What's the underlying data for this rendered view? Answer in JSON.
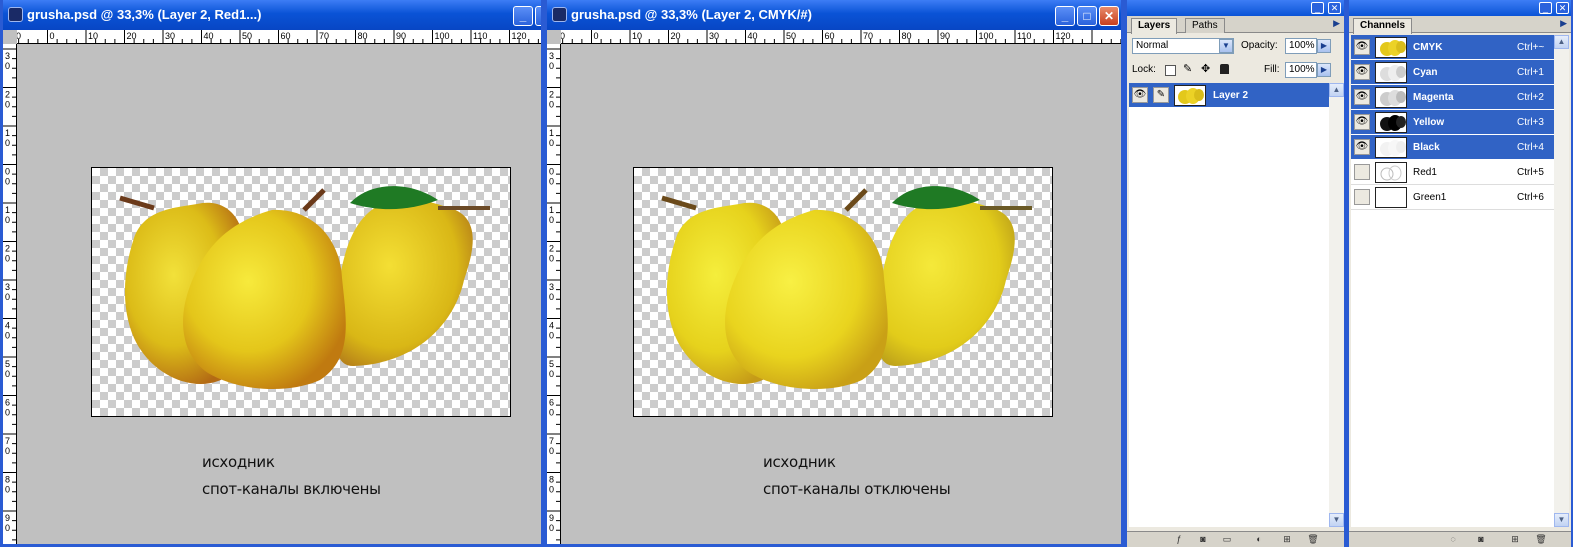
{
  "windows": [
    {
      "title": "grusha.psd @ 33,3% (Layer 2, Red1...)",
      "caption_line1": "исходник",
      "caption_line2": "спот-каналы включены"
    },
    {
      "title": "grusha.psd @ 33,3% (Layer 2, CMYK/#)",
      "caption_line1": "исходник",
      "caption_line2": "спот-каналы отключены"
    }
  ],
  "ruler": {
    "h_labels": [
      "10",
      "0",
      "10",
      "20",
      "30",
      "40",
      "50",
      "60",
      "70",
      "80",
      "90",
      "100",
      "110",
      "120"
    ],
    "v_labels": [
      "3",
      "2",
      "1",
      "0",
      "1",
      "2",
      "3",
      "4",
      "5",
      "6",
      "7",
      "8",
      "9"
    ]
  },
  "layers_panel": {
    "tabs": [
      "Layers",
      "Paths"
    ],
    "blend_mode": "Normal",
    "opacity_label": "Opacity:",
    "opacity_value": "100%",
    "lock_label": "Lock:",
    "fill_label": "Fill:",
    "fill_value": "100%",
    "layers": [
      {
        "name": "Layer 2"
      }
    ]
  },
  "channels_panel": {
    "tabs": [
      "Channels"
    ],
    "channels": [
      {
        "name": "CMYK",
        "shortcut": "Ctrl+~",
        "visible": true,
        "selected": true
      },
      {
        "name": "Cyan",
        "shortcut": "Ctrl+1",
        "visible": true,
        "selected": true
      },
      {
        "name": "Magenta",
        "shortcut": "Ctrl+2",
        "visible": true,
        "selected": true
      },
      {
        "name": "Yellow",
        "shortcut": "Ctrl+3",
        "visible": true,
        "selected": true
      },
      {
        "name": "Black",
        "shortcut": "Ctrl+4",
        "visible": true,
        "selected": true
      },
      {
        "name": "Red1",
        "shortcut": "Ctrl+5",
        "visible": false,
        "selected": false
      },
      {
        "name": "Green1",
        "shortcut": "Ctrl+6",
        "visible": false,
        "selected": false
      }
    ]
  },
  "icons": {
    "eye": "eye-icon",
    "brush": "brush-icon",
    "minimize": "minimize-icon",
    "maximize": "maximize-icon",
    "close": "close-icon"
  },
  "colors": {
    "title_blue": "#0a53d6",
    "selection_blue": "#3163c5",
    "canvas_gray": "#c0c0c0",
    "pear_yellow": "#e8cc1e"
  }
}
